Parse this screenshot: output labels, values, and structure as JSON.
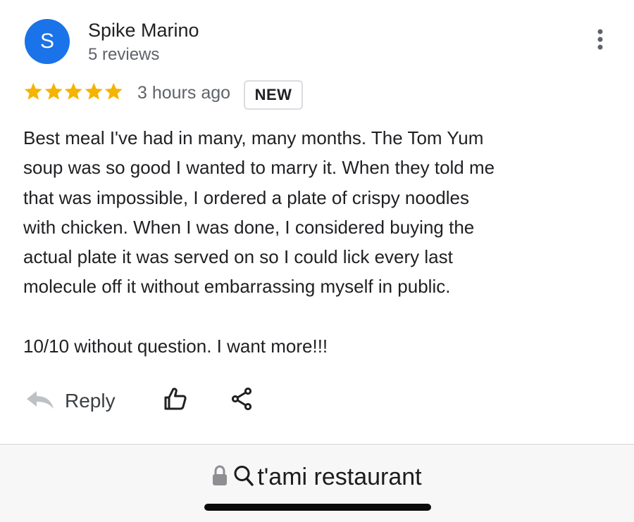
{
  "review": {
    "avatar_letter": "S",
    "reviewer_name": "Spike Marino",
    "review_count": "5 reviews",
    "rating": 5,
    "rating_max": 5,
    "time_ago": "3 hours ago",
    "badge": "NEW",
    "body_lines": [
      "Best meal I've had in many, many months. The Tom Yum",
      "soup was so good I wanted to marry it. When they told me",
      "that was impossible, I ordered a plate of crispy noodles",
      "with chicken. When I was done, I considered buying the",
      "actual plate it was served on so I could lick every last",
      "molecule off it without embarrassing myself in public.",
      "",
      "10/10 without question. I want more!!!"
    ]
  },
  "actions": {
    "reply_label": "Reply",
    "like_icon": "thumbs-up-icon",
    "share_icon": "share-icon"
  },
  "browser": {
    "address_text": "t'ami restaurant",
    "lock_icon": "lock-icon",
    "search_icon": "search-icon"
  },
  "colors": {
    "star": "#f4b400",
    "avatar": "#1a73e8",
    "text_primary": "#202124",
    "text_secondary": "#5f6368"
  }
}
